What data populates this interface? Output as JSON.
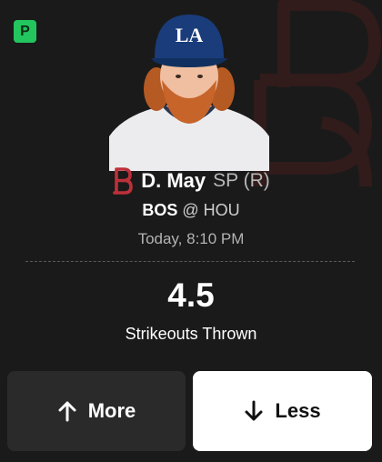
{
  "colors": {
    "background": "#1a1a1a",
    "promo_badge": "#22c55e",
    "red_sox_red": "#bd3039",
    "dodgers_blue": "#1a3c7a",
    "more_button_bg": "#2a2a2a",
    "less_button_bg": "#ffffff"
  },
  "badge": {
    "label": "P"
  },
  "player": {
    "name": "D. May",
    "position": "SP (R)",
    "photo": "player-headshot",
    "team_logo": "red-sox-logo"
  },
  "matchup": {
    "team": "BOS",
    "separator": "@",
    "opponent": "HOU"
  },
  "game_time": "Today, 8:10 PM",
  "projection": {
    "value": "4.5",
    "stat": "Strikeouts Thrown"
  },
  "actions": {
    "more": {
      "label": "More",
      "icon": "arrow-up-icon"
    },
    "less": {
      "label": "Less",
      "icon": "arrow-down-icon"
    }
  }
}
